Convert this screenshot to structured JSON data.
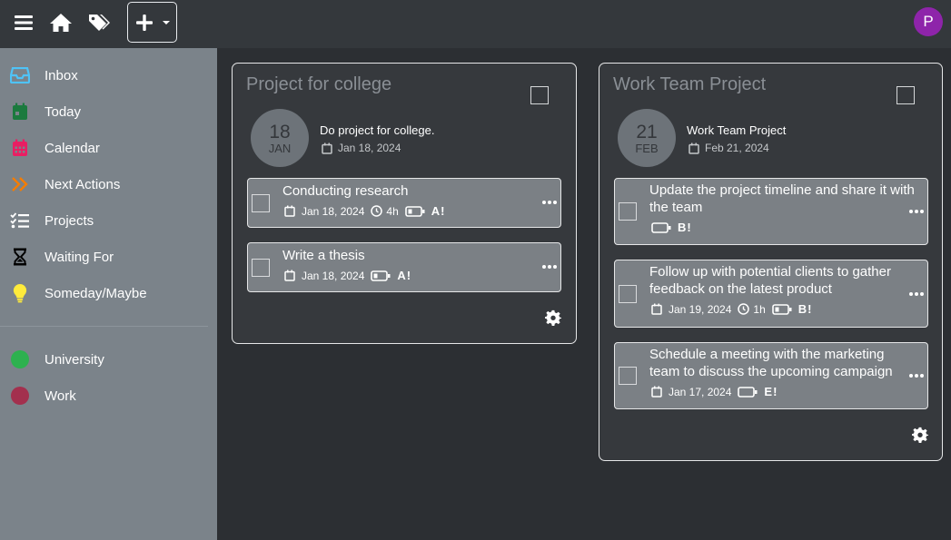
{
  "topbar": {
    "menu_icon": "hamburger-icon",
    "home_icon": "home-icon",
    "tags_icon": "tags-icon",
    "add_icon": "plus-icon",
    "avatar_letter": "P",
    "avatar_color": "#8e24aa"
  },
  "sidebar": {
    "items": [
      {
        "label": "Inbox",
        "icon": "inbox-icon",
        "color": "#4fc3f7"
      },
      {
        "label": "Today",
        "icon": "calendar-day-icon",
        "color": "#1b7a3e"
      },
      {
        "label": "Calendar",
        "icon": "calendar-icon",
        "color": "#e91e63"
      },
      {
        "label": "Next Actions",
        "icon": "double-chevron-right-icon",
        "color": "#f57c00"
      },
      {
        "label": "Projects",
        "icon": "list-check-icon",
        "color": "#ffffff"
      },
      {
        "label": "Waiting For",
        "icon": "hourglass-icon",
        "color": "#000000"
      },
      {
        "label": "Someday/Maybe",
        "icon": "lightbulb-icon",
        "color": "#ffeb3b"
      }
    ],
    "contexts": [
      {
        "label": "University",
        "color": "#2db14f"
      },
      {
        "label": "Work",
        "color": "#a3304e"
      }
    ]
  },
  "projects": [
    {
      "title": "Project for college",
      "day": "18",
      "month": "JAN",
      "description": "Do project for college.",
      "date": "Jan 18, 2024",
      "tasks": [
        {
          "title": "Conducting research",
          "date": "Jan 18, 2024",
          "duration": "4h",
          "priority": "A!"
        },
        {
          "title": "Write a thesis",
          "date": "Jan 18, 2024",
          "priority": "A!"
        }
      ]
    },
    {
      "title": "Work Team Project",
      "day": "21",
      "month": "FEB",
      "description": "Work Team Project",
      "date": "Feb 21, 2024",
      "tasks": [
        {
          "title": "Update the project timeline and share it with the team",
          "priority": "B!"
        },
        {
          "title": "Follow up with potential clients to gather feedback on the latest product",
          "date": "Jan 19, 2024",
          "duration": "1h",
          "priority": "B!"
        },
        {
          "title": "Schedule a meeting with the marketing team to discuss the upcoming campaign",
          "date": "Jan 17, 2024",
          "priority": "E!"
        }
      ]
    }
  ]
}
